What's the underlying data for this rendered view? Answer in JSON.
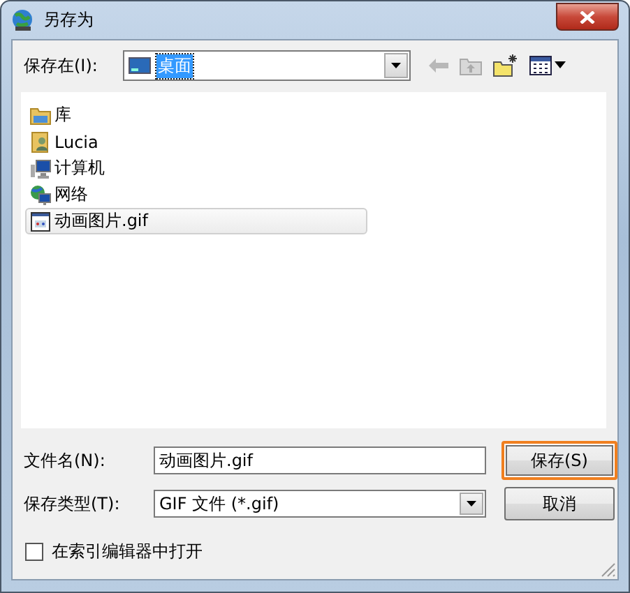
{
  "window": {
    "title": "另存为"
  },
  "save_in": {
    "label": "保存在(I):",
    "value": "桌面"
  },
  "files": [
    {
      "name": "库",
      "kind": "library",
      "selected": false
    },
    {
      "name": "Lucia",
      "kind": "user",
      "selected": false
    },
    {
      "name": "计算机",
      "kind": "computer",
      "selected": false
    },
    {
      "name": "网络",
      "kind": "network",
      "selected": false
    },
    {
      "name": "动画图片.gif",
      "kind": "gif",
      "selected": true
    }
  ],
  "file_name": {
    "label": "文件名(N):",
    "value": "动画图片.gif"
  },
  "file_type": {
    "label": "保存类型(T):",
    "value": "GIF 文件 (*.gif)"
  },
  "buttons": [
    {
      "label": "保存(S)",
      "focused": true
    },
    {
      "label": "取消",
      "focused": false
    }
  ],
  "open_in_index": {
    "label": "在索引编辑器中打开",
    "checked": false
  }
}
